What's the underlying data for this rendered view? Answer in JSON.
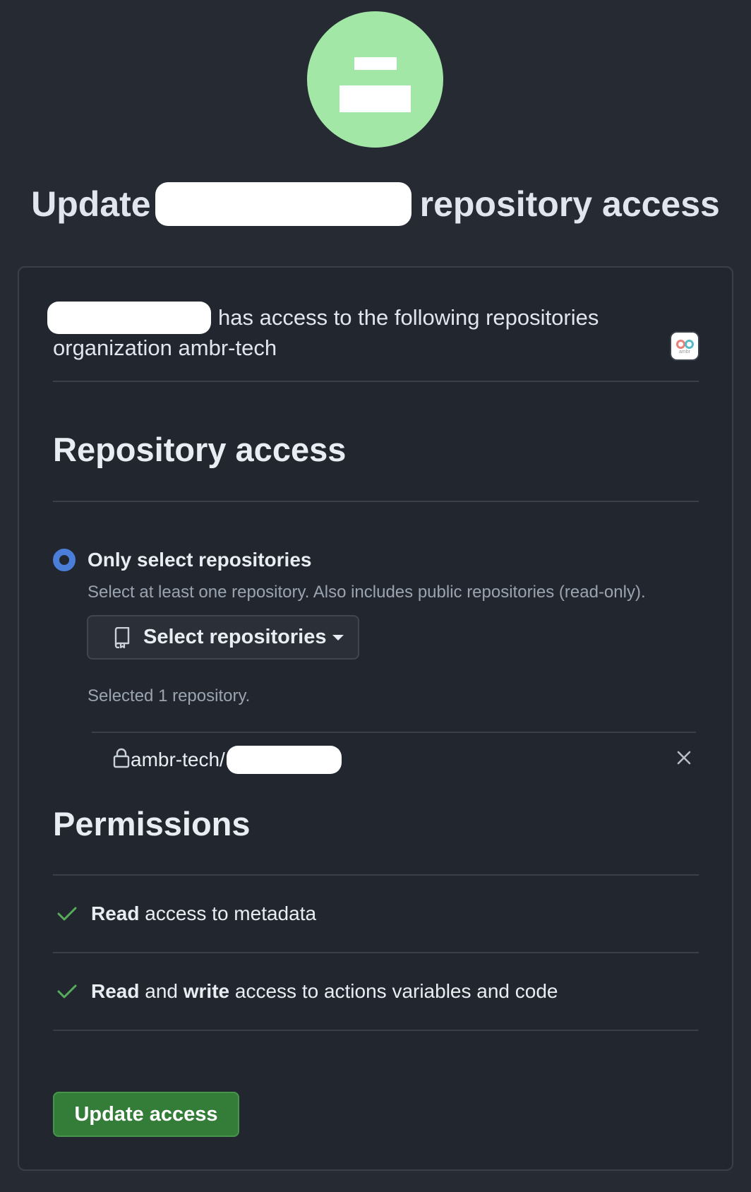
{
  "header": {
    "title_prefix": "Update",
    "title_suffix": "repository access"
  },
  "intro": {
    "line1_suffix": "has access to the following repositories",
    "line2": "organization ambr-tech",
    "org_logo_text": "ambr"
  },
  "repository_access": {
    "heading": "Repository access",
    "option_label": "Only select repositories",
    "option_help": "Select at least one repository. Also includes public repositories (read-only).",
    "select_button_label": "Select repositories",
    "selected_count": "Selected 1 repository.",
    "selected_repo_prefix": "ambr-tech/"
  },
  "permissions": {
    "heading": "Permissions",
    "items": [
      {
        "bold": "Read",
        "rest": " access to metadata"
      },
      {
        "bold1": "Read",
        "mid": " and ",
        "bold2": "write",
        "rest": " access to actions variables and code"
      }
    ]
  },
  "actions": {
    "update_label": "Update access"
  },
  "colors": {
    "background": "#262a33",
    "card": "#22272f",
    "accent_radio": "#4a7ed8",
    "primary_button": "#347d39",
    "check": "#57ab5a",
    "avatar": "#a2e7a6"
  }
}
